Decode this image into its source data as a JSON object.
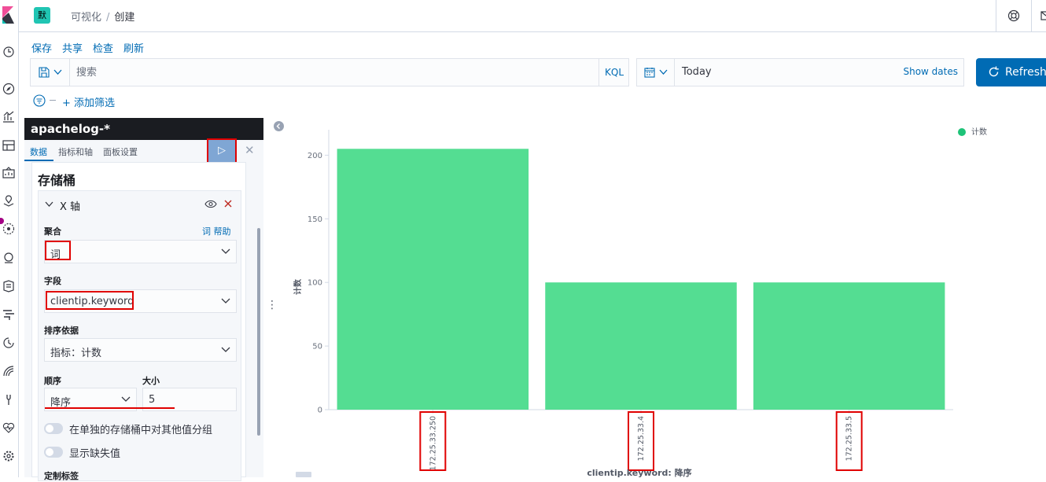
{
  "header": {
    "space_badge": "默",
    "breadcrumb_parent": "可视化",
    "breadcrumb_current": "创建"
  },
  "top_menu": {
    "save": "保存",
    "share": "共享",
    "inspect": "检查",
    "refresh": "刷新"
  },
  "query_bar": {
    "search_placeholder": "搜索",
    "language": "KQL",
    "date_value": "Today",
    "show_dates": "Show dates",
    "refresh_button": "Refresh"
  },
  "filter_bar": {
    "add_filter": "+ 添加筛选"
  },
  "editor": {
    "index_pattern": "apachelog-*",
    "tabs": [
      "数据",
      "指标和轴",
      "面板设置"
    ],
    "buckets_title": "存储桶",
    "x_axis": {
      "title": "X 轴",
      "aggregation_label": "聚合",
      "aggregation_help": "词 帮助",
      "aggregation_value": "词",
      "field_label": "字段",
      "field_value": "clientip.keyword",
      "order_by_label": "排序依据",
      "order_by_value": "指标：计数",
      "order_label": "顺序",
      "order_value": "降序",
      "size_label": "大小",
      "size_value": "5",
      "group_other_label": "在单独的存储桶中对其他值分组",
      "show_missing_label": "显示缺失值",
      "custom_label": "定制标签"
    }
  },
  "colors": {
    "bar": "#54dd92",
    "legend_dot": "#1ec378",
    "accent": "#006bb4",
    "annotation_red": "#e00000",
    "panel_dark": "#1a1c21"
  },
  "chart_data": {
    "type": "bar",
    "categories": [
      "172.25.33.250",
      "172.25.33.4",
      "172.25.33.5"
    ],
    "series": [
      {
        "name": "计数",
        "values": [
          205,
          100,
          100
        ]
      }
    ],
    "xlabel": "clientip.keyword: 降序",
    "ylabel": "计数",
    "yticks": [
      0,
      50,
      100,
      150,
      200
    ],
    "ylim": [
      0,
      220
    ],
    "legend": "top-right",
    "grid": false
  }
}
